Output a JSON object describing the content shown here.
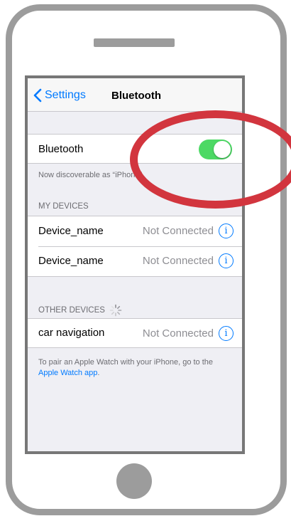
{
  "nav": {
    "back_label": "Settings",
    "title": "Bluetooth"
  },
  "bluetooth": {
    "label": "Bluetooth",
    "enabled": true,
    "discoverable_text": "Now discoverable as “iPhone”."
  },
  "my_devices": {
    "header": "MY DEVICES",
    "items": [
      {
        "name": "Device_name",
        "status": "Not Connected"
      },
      {
        "name": "Device_name",
        "status": "Not Connected"
      }
    ]
  },
  "other_devices": {
    "header": "OTHER DEVICES",
    "items": [
      {
        "name": "car navigation",
        "status": "Not Connected"
      }
    ]
  },
  "footer": {
    "text": "To pair an Apple Watch with your iPhone, go to the",
    "link": "Apple Watch app",
    "suffix": "."
  },
  "icons": {
    "info": "i"
  },
  "colors": {
    "accent": "#007aff",
    "toggle_on": "#4cd964",
    "annotation": "#d2353e"
  }
}
